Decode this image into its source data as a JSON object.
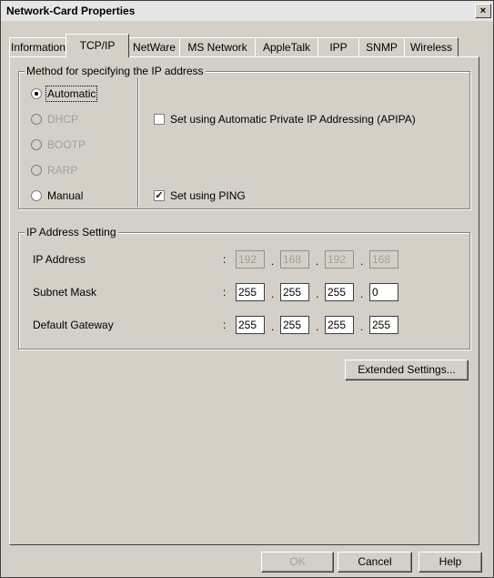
{
  "window": {
    "title": "Network-Card Properties",
    "close_glyph": "×"
  },
  "tabs": [
    {
      "label": "Information"
    },
    {
      "label": "TCP/IP"
    },
    {
      "label": "NetWare"
    },
    {
      "label": "MS Network"
    },
    {
      "label": "AppleTalk"
    },
    {
      "label": "IPP"
    },
    {
      "label": "SNMP"
    },
    {
      "label": "Wireless"
    }
  ],
  "method_group": {
    "legend": "Method for specifying the IP address",
    "options": [
      {
        "label": "Automatic",
        "selected": true,
        "enabled": true
      },
      {
        "label": "DHCP",
        "selected": false,
        "enabled": false
      },
      {
        "label": "BOOTP",
        "selected": false,
        "enabled": false
      },
      {
        "label": "RARP",
        "selected": false,
        "enabled": false
      },
      {
        "label": "Manual",
        "selected": false,
        "enabled": true
      }
    ],
    "apipa": {
      "label": "Set using Automatic Private IP Addressing (APIPA)",
      "checked": false
    },
    "ping": {
      "label": "Set using PING",
      "checked": true
    }
  },
  "ip_group": {
    "legend": "IP Address Setting",
    "colon": ":",
    "dot": ".",
    "rows": [
      {
        "label": "IP Address",
        "octets": [
          "192",
          "168",
          "192",
          "168"
        ],
        "enabled": false
      },
      {
        "label": "Subnet Mask",
        "octets": [
          "255",
          "255",
          "255",
          "0"
        ],
        "enabled": true
      },
      {
        "label": "Default Gateway",
        "octets": [
          "255",
          "255",
          "255",
          "255"
        ],
        "enabled": true
      }
    ]
  },
  "extended_button": "Extended Settings...",
  "footer": {
    "ok": "OK",
    "cancel": "Cancel",
    "help": "Help"
  }
}
